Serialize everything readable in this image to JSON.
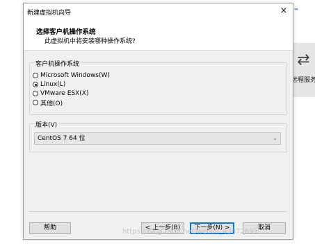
{
  "background": {
    "tm": "™",
    "arrows": "⇄",
    "label": "远程服务"
  },
  "dialog": {
    "title": "新建虚拟机向导",
    "close": "×",
    "header_title": "选择客户机操作系统",
    "header_subtitle": "此虚拟机中将安装哪种操作系统?",
    "os_group_label": "客户机操作系统",
    "os_options": [
      {
        "label": "Microsoft Windows(W)",
        "checked": false
      },
      {
        "label": "Linux(L)",
        "checked": true
      },
      {
        "label": "VMware ESX(X)",
        "checked": false
      },
      {
        "label": "其他(O)",
        "checked": false
      }
    ],
    "version_group_label": "版本(V)",
    "version_value": "CentOS 7 64 位",
    "buttons": {
      "help": "帮助",
      "back": "< 上一步(B)",
      "next": "下一步(N) >",
      "cancel": "取消"
    }
  },
  "watermark": "https://blog.csdn.net/weixin_43872693"
}
